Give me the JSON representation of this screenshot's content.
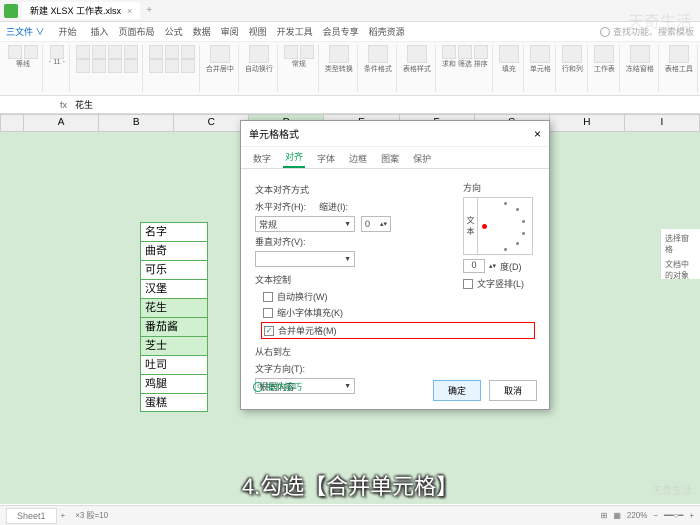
{
  "titlebar": {
    "filename": "新建 XLSX 工作表.xlsx"
  },
  "menu": {
    "items": [
      "三文件 ∨",
      "开始",
      "插入",
      "页面布局",
      "公式",
      "数据",
      "审阅",
      "视图",
      "开发工具",
      "会员专享",
      "稻壳资源"
    ],
    "search_placeholder": "查找功能、搜索模板"
  },
  "ribbon": {
    "groups": [
      "等线",
      "- 11 -",
      "A⁺ A⁻",
      "A",
      "类型转换",
      "行和列",
      "工作表",
      "冻结窗格",
      "表格工具"
    ]
  },
  "formula": {
    "name": "",
    "fx": "fx",
    "value": "花生"
  },
  "columns": [
    "A",
    "B",
    "C",
    "D",
    "E",
    "F",
    "G",
    "H",
    "I"
  ],
  "cells": [
    "名字",
    "曲奇",
    "可乐",
    "汉堡",
    "花生",
    "番茄酱",
    "芝士",
    "吐司",
    "鸡腿",
    "蛋糕"
  ],
  "dialog": {
    "title": "单元格格式",
    "tabs": [
      "数字",
      "对齐",
      "字体",
      "边框",
      "图案",
      "保护"
    ],
    "active_tab": "对齐",
    "text_align_section": "文本对齐方式",
    "h_align_label": "水平对齐(H):",
    "h_align_value": "常规",
    "indent_label": "缩进(I):",
    "indent_value": "0",
    "v_align_label": "垂直对齐(V):",
    "text_control_section": "文本控制",
    "check1": "自动换行(W)",
    "check2": "缩小字体填充(K)",
    "check3": "合并单元格(M)",
    "rtl_section": "从右到左",
    "text_dir_label": "文字方向(T):",
    "text_dir_value": "根据内容",
    "orient_section": "方向",
    "orient_v": "文本",
    "degree_label": "度(D)",
    "degree_value": "0",
    "spacing_check": "文字竖排(L)",
    "tip": "操作技巧",
    "ok": "确定",
    "cancel": "取消"
  },
  "sheet_tab": "Sheet1",
  "status": {
    "info": "×3 殴=10",
    "zoom": "220%"
  },
  "caption": "4.勾选【合并单元格】",
  "side": {
    "title": "选择窗格",
    "text": "文档中的对象"
  },
  "watermark": "天奇生活",
  "watermark2": "天奇生活"
}
